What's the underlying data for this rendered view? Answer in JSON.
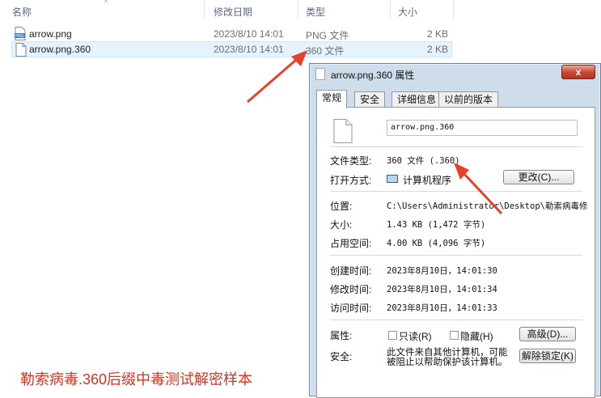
{
  "explorer": {
    "columns": [
      "名称",
      "修改日期",
      "类型",
      "大小"
    ],
    "files": [
      {
        "name": "arrow.png",
        "modified": "2023/8/10 14:01",
        "type": "PNG 文件",
        "size": "2 KB"
      },
      {
        "name": "arrow.png.360",
        "modified": "2023/8/10 14:01",
        "type": "360 文件",
        "size": "2 KB"
      }
    ]
  },
  "dialog": {
    "title": "arrow.png.360 属性",
    "close_glyph": "x",
    "tabs": [
      "常规",
      "安全",
      "详细信息",
      "以前的版本"
    ],
    "filename": "arrow.png.360",
    "file_type_label": "文件类型:",
    "file_type_value": "360 文件 (.360)",
    "open_with_label": "打开方式:",
    "open_with_value": "计算机程序",
    "change_button": "更改(C)...",
    "location_label": "位置:",
    "location_value": "C:\\Users\\Administrator\\Desktop\\勒索病毒修",
    "size_label": "大小:",
    "size_value": "1.43 KB (1,472 字节)",
    "disk_size_label": "占用空间:",
    "disk_size_value": "4.00 KB (4,096 字节)",
    "created_label": "创建时间:",
    "created_value": "2023年8月10日，14:01:30",
    "modified_label": "修改时间:",
    "modified_value": "2023年8月10日，14:01:34",
    "accessed_label": "访问时间:",
    "accessed_value": "2023年8月10日，14:01:33",
    "attributes_label": "属性:",
    "readonly_label": "只读(R)",
    "hidden_label": "隐藏(H)",
    "advanced_button": "高级(D)...",
    "security_label": "安全:",
    "security_text": "此文件来自其他计算机，可能被阻止以帮助保护该计算机。",
    "unblock_button": "解除锁定(K)"
  },
  "caption": "勒索病毒.360后缀中毒测试解密样本",
  "colors": {
    "annotation_red": "#e8402a",
    "caption_red": "#d9321f",
    "selection": "#e5f3ff"
  },
  "icons": [
    "png-file-icon",
    "blank-file-icon",
    "application-icon"
  ]
}
